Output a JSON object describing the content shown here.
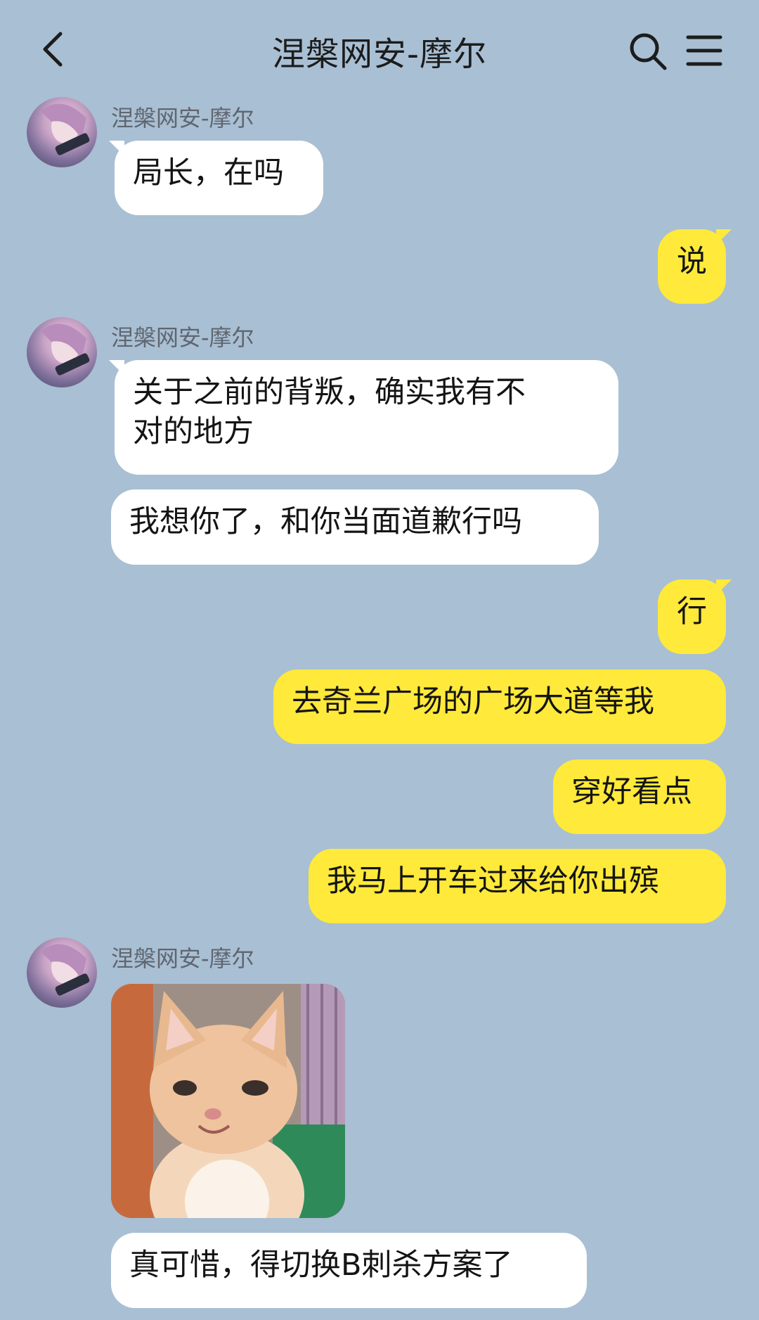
{
  "header": {
    "title": "涅槃网安-摩尔",
    "back_icon": "chevron-left-icon",
    "search_icon": "search-icon",
    "menu_icon": "menu-icon"
  },
  "messages": [
    {
      "sender": "涅槃网安-摩尔",
      "text": "局长，在吗"
    },
    {
      "text": "说"
    },
    {
      "sender": "涅槃网安-摩尔",
      "text": "关于之前的背叛，确实我有不\n对的地方"
    },
    {
      "text": "我想你了，和你当面道歉行吗"
    },
    {
      "text": "行"
    },
    {
      "text": "去奇兰广场的广场大道等我"
    },
    {
      "text": "穿好看点"
    },
    {
      "text": "我马上开车过来给你出殡"
    },
    {
      "sender": "涅槃网安-摩尔",
      "sticker": "kitten-sticker"
    },
    {
      "text": "真可惜，得切换B刺杀方案了"
    }
  ],
  "colors": {
    "background": "#a9bfd3",
    "incoming_bubble": "#ffffff",
    "outgoing_bubble": "#ffe93a"
  }
}
